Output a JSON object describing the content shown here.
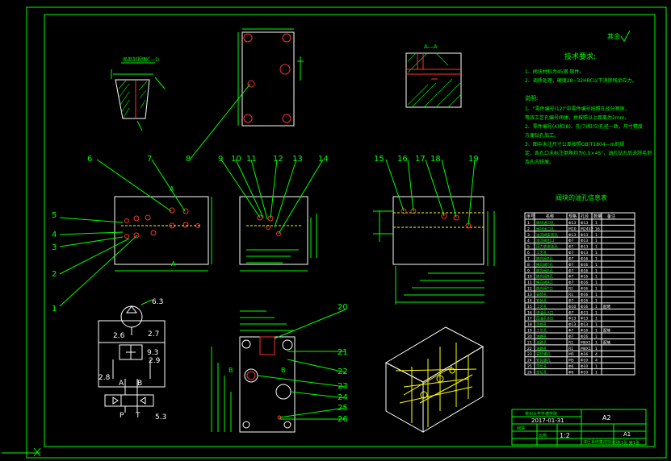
{
  "section_labels": {
    "section_aa": "A—A",
    "detail_view": "局部剖视图C—D",
    "view_a_top": "A",
    "view_a_bottom": "A",
    "side_b_left": "B",
    "side_b_right": "B",
    "sym_a": "A",
    "sym_b": "B",
    "sym_p": "P",
    "sym_t": "T"
  },
  "callouts": {
    "c1": "1",
    "c2": "2",
    "c3": "3",
    "c4": "4",
    "c5": "5",
    "c6": "6",
    "c7": "7",
    "c8": "8",
    "c9": "9",
    "c10": "10",
    "c11": "11",
    "c12": "12",
    "c13": "13",
    "c14": "14",
    "c15": "15",
    "c16": "16",
    "c17": "17",
    "c18": "18",
    "c19": "19",
    "c20": "20",
    "c21": "21",
    "c22": "22",
    "c23": "23",
    "c24": "24",
    "c25": "25",
    "c26": "26"
  },
  "hydraulic_labels": {
    "h63": "6.3",
    "h26": "2.6",
    "h27": "2.7",
    "h93": "9.3",
    "h29": "2.9",
    "h28": "2.8",
    "h53": "5.3"
  },
  "notes": {
    "roughness": "其余",
    "title": "技术要求:",
    "lines": [
      "1、阀块材料为45钢 锻件。",
      "2、调质处理，硬度28~32HRC以下消除残余应力。",
      "",
      "说明:",
      "1、\"零件编号(12)\"中零件编号按照孔径分顺序，",
      "等效工艺孔编号阀体，并按照以上距离为2mm。",
      "2、零件编号(4)和(8)、孔(7)和(5)孔径一致，尺寸精度",
      "方便钻孔加工。",
      "3、图中未注尺寸公差按照GB/T1804—m的规",
      "定，各孔口未标注倒角均为0.5×45°，油孔钻孔后去除毛刺",
      "及孔内铁屑。"
    ]
  },
  "table": {
    "title": "阀块的油孔信息表",
    "header": [
      "序号",
      "名称",
      "规格",
      "孔径",
      "数量",
      "备注"
    ],
    "rows": [
      [
        "1",
        "阀块进口孔",
        "Φ13",
        "Φ13",
        "1",
        ""
      ],
      [
        "2",
        "阀块出口孔",
        "M10",
        "M24X2",
        "16",
        ""
      ],
      [
        "3",
        "溢流阀安装孔",
        "Φ13",
        "Φ13",
        "1",
        ""
      ],
      [
        "4",
        "溢流阀出口",
        "Φ7",
        "Φ13",
        "1",
        ""
      ],
      [
        "5",
        "压力表安装孔",
        "Φ7",
        "Φ13",
        "1",
        ""
      ],
      [
        "6",
        "工艺孔",
        "Φ7",
        "Φ13",
        "1",
        ""
      ],
      [
        "7",
        "换向阀P孔",
        "Φ7",
        "Φ16",
        "1",
        ""
      ],
      [
        "8",
        "换向阀T孔",
        "Φ7",
        "Φ16",
        "1",
        ""
      ],
      [
        "9",
        "换向阀A孔",
        "Φ7",
        "Φ16",
        "1",
        ""
      ],
      [
        "10",
        "换向阀B孔",
        "Φ7",
        "Φ16",
        "1",
        ""
      ],
      [
        "11",
        "换向阀P口",
        "Φ7",
        "Φ16",
        "1",
        ""
      ],
      [
        "12",
        "换向阀T口",
        "R1",
        "Φ16",
        "1",
        ""
      ],
      [
        "13",
        "安装孔",
        "R1",
        "Φ16",
        "1",
        ""
      ],
      [
        "14",
        "安装孔",
        "Φ7",
        "Φ16",
        "1",
        ""
      ],
      [
        "15",
        "工艺孔",
        "Φ10",
        "Φ16",
        "1",
        "配堵"
      ],
      [
        "16",
        "进油孔A口",
        "Φ7",
        "Φ13",
        "1",
        ""
      ],
      [
        "17",
        "回油孔B口",
        "Φ13",
        "Φ13",
        "1",
        ""
      ],
      [
        "18",
        "连接孔",
        "Φ13",
        "Φ13",
        "1",
        ""
      ],
      [
        "19",
        "工艺孔",
        "Φ7",
        "Φ16",
        "1",
        "配堵"
      ],
      [
        "20",
        "油路孔",
        "Φ7",
        "Φ16",
        "1",
        ""
      ],
      [
        "21",
        "油路孔",
        "R1",
        "M8X1",
        "1",
        "配堵"
      ],
      [
        "22",
        "油路孔",
        "R1",
        "M8X1",
        "1",
        ""
      ],
      [
        "23",
        "安装螺孔",
        "M5",
        "Φ16",
        "4",
        ""
      ],
      [
        "24",
        "安装螺孔",
        "M5",
        "Φ10",
        "4",
        ""
      ],
      [
        "25",
        "定位孔",
        "Φ6",
        "Φ10",
        "1",
        ""
      ],
      [
        "26",
        "定位孔",
        "Φ6",
        "Φ10",
        "1",
        ""
      ]
    ]
  },
  "title_block": {
    "school": "常州大学怀德学院",
    "drawing_no": "2017-01-31",
    "sheet": "A2",
    "scale_label": "比例",
    "scale": "1:2",
    "drawing_name": "液压系统集成块设计",
    "part_name": "阀块",
    "format": "A1",
    "sheet_info": "共1张 第1张"
  },
  "colors": {
    "frame": "#00ff00",
    "part": "#ffffff",
    "dimensions": "#00ff00",
    "hidden": "#ffff00",
    "section": "#ff3030",
    "background": "#000000"
  }
}
